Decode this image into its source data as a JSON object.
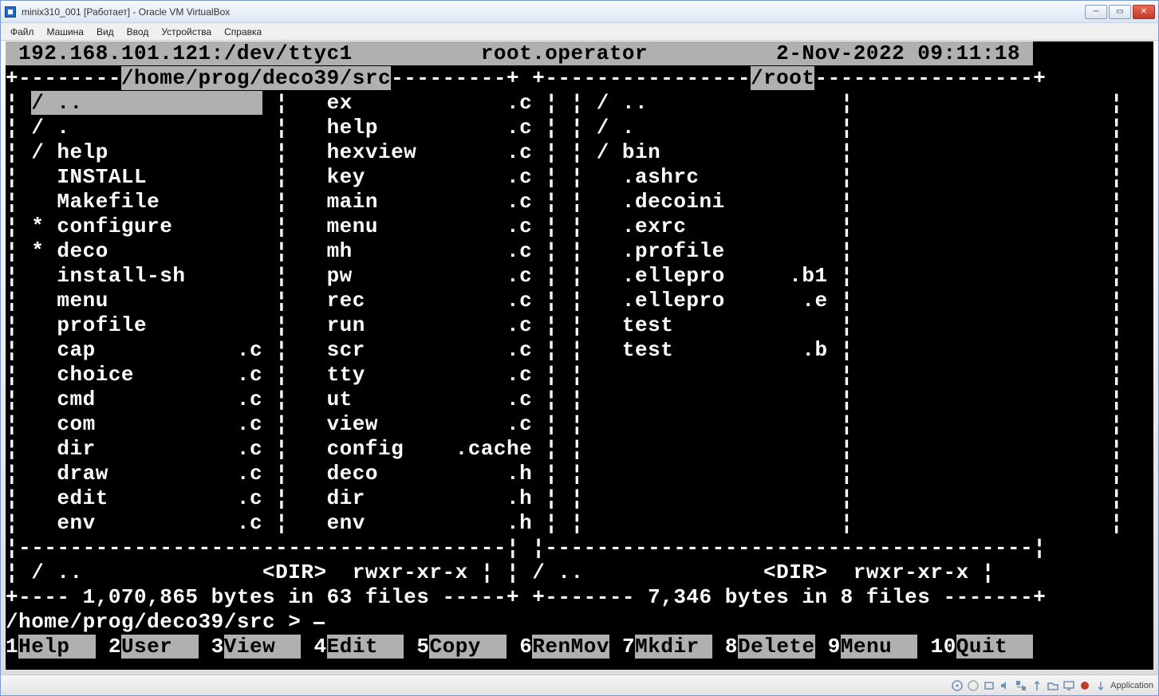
{
  "window": {
    "title": "minix310_001 [Работает] - Oracle VM VirtualBox"
  },
  "menu": [
    "Файл",
    "Машина",
    "Вид",
    "Ввод",
    "Устройства",
    "Справка"
  ],
  "header": {
    "ip_tty": "192.168.101.121:/dev/ttyc1",
    "user": "root.operator",
    "datetime": "2-Nov-2022 09:11:18"
  },
  "left_panel": {
    "path": "/home/prog/deco39/src",
    "col1": [
      {
        "mark": "/",
        "name": "..",
        "ext": "",
        "selected": true
      },
      {
        "mark": "/",
        "name": ".",
        "ext": ""
      },
      {
        "mark": "/",
        "name": "help",
        "ext": ""
      },
      {
        "mark": " ",
        "name": "INSTALL",
        "ext": ""
      },
      {
        "mark": " ",
        "name": "Makefile",
        "ext": ""
      },
      {
        "mark": "*",
        "name": "configure",
        "ext": ""
      },
      {
        "mark": "*",
        "name": "deco",
        "ext": ""
      },
      {
        "mark": " ",
        "name": "install-sh",
        "ext": ""
      },
      {
        "mark": " ",
        "name": "menu",
        "ext": ""
      },
      {
        "mark": " ",
        "name": "profile",
        "ext": ""
      },
      {
        "mark": " ",
        "name": "cap",
        "ext": ".c"
      },
      {
        "mark": " ",
        "name": "choice",
        "ext": ".c"
      },
      {
        "mark": " ",
        "name": "cmd",
        "ext": ".c"
      },
      {
        "mark": " ",
        "name": "com",
        "ext": ".c"
      },
      {
        "mark": " ",
        "name": "dir",
        "ext": ".c"
      },
      {
        "mark": " ",
        "name": "draw",
        "ext": ".c"
      },
      {
        "mark": " ",
        "name": "edit",
        "ext": ".c"
      },
      {
        "mark": " ",
        "name": "env",
        "ext": ".c"
      }
    ],
    "col2": [
      {
        "mark": " ",
        "name": "ex",
        "ext": ".c"
      },
      {
        "mark": " ",
        "name": "help",
        "ext": ".c"
      },
      {
        "mark": " ",
        "name": "hexview",
        "ext": ".c"
      },
      {
        "mark": " ",
        "name": "key",
        "ext": ".c"
      },
      {
        "mark": " ",
        "name": "main",
        "ext": ".c"
      },
      {
        "mark": " ",
        "name": "menu",
        "ext": ".c"
      },
      {
        "mark": " ",
        "name": "mh",
        "ext": ".c"
      },
      {
        "mark": " ",
        "name": "pw",
        "ext": ".c"
      },
      {
        "mark": " ",
        "name": "rec",
        "ext": ".c"
      },
      {
        "mark": " ",
        "name": "run",
        "ext": ".c"
      },
      {
        "mark": " ",
        "name": "scr",
        "ext": ".c"
      },
      {
        "mark": " ",
        "name": "tty",
        "ext": ".c"
      },
      {
        "mark": " ",
        "name": "ut",
        "ext": ".c"
      },
      {
        "mark": " ",
        "name": "view",
        "ext": ".c"
      },
      {
        "mark": " ",
        "name": "config",
        "ext": ".cache"
      },
      {
        "mark": " ",
        "name": "deco",
        "ext": ".h"
      },
      {
        "mark": " ",
        "name": "dir",
        "ext": ".h"
      },
      {
        "mark": " ",
        "name": "env",
        "ext": ".h"
      }
    ],
    "footer_item": {
      "mark": "/",
      "name": "..",
      "type": "<DIR>",
      "perms": "rwxr-xr-x"
    },
    "summary": "1,070,865 bytes in 63 files"
  },
  "right_panel": {
    "path": "/root",
    "col1": [
      {
        "mark": "/",
        "name": "..",
        "ext": ""
      },
      {
        "mark": "/",
        "name": ".",
        "ext": ""
      },
      {
        "mark": "/",
        "name": "bin",
        "ext": ""
      },
      {
        "mark": " ",
        "name": ".ashrc",
        "ext": ""
      },
      {
        "mark": " ",
        "name": ".decoini",
        "ext": ""
      },
      {
        "mark": " ",
        "name": ".exrc",
        "ext": ""
      },
      {
        "mark": " ",
        "name": ".profile",
        "ext": ""
      },
      {
        "mark": " ",
        "name": ".ellepro",
        "ext": ".b1"
      },
      {
        "mark": " ",
        "name": ".ellepro",
        "ext": ".e"
      },
      {
        "mark": " ",
        "name": "test",
        "ext": ""
      },
      {
        "mark": " ",
        "name": "test",
        "ext": ".b"
      }
    ],
    "footer_item": {
      "mark": "/",
      "name": "..",
      "type": "<DIR>",
      "perms": "rwxr-xr-x"
    },
    "summary": "7,346 bytes in 8 files"
  },
  "prompt": {
    "path": "/home/prog/deco39/src",
    "symbol": ">"
  },
  "fkeys": [
    {
      "n": "1",
      "label": "Help"
    },
    {
      "n": "2",
      "label": "User"
    },
    {
      "n": "3",
      "label": "View"
    },
    {
      "n": "4",
      "label": "Edit"
    },
    {
      "n": "5",
      "label": "Copy"
    },
    {
      "n": "6",
      "label": "RenMov"
    },
    {
      "n": "7",
      "label": "Mkdir"
    },
    {
      "n": "8",
      "label": "Delete"
    },
    {
      "n": "9",
      "label": "Menu"
    },
    {
      "n": "10",
      "label": "Quit"
    }
  ],
  "statusbar": {
    "label": "Application"
  }
}
